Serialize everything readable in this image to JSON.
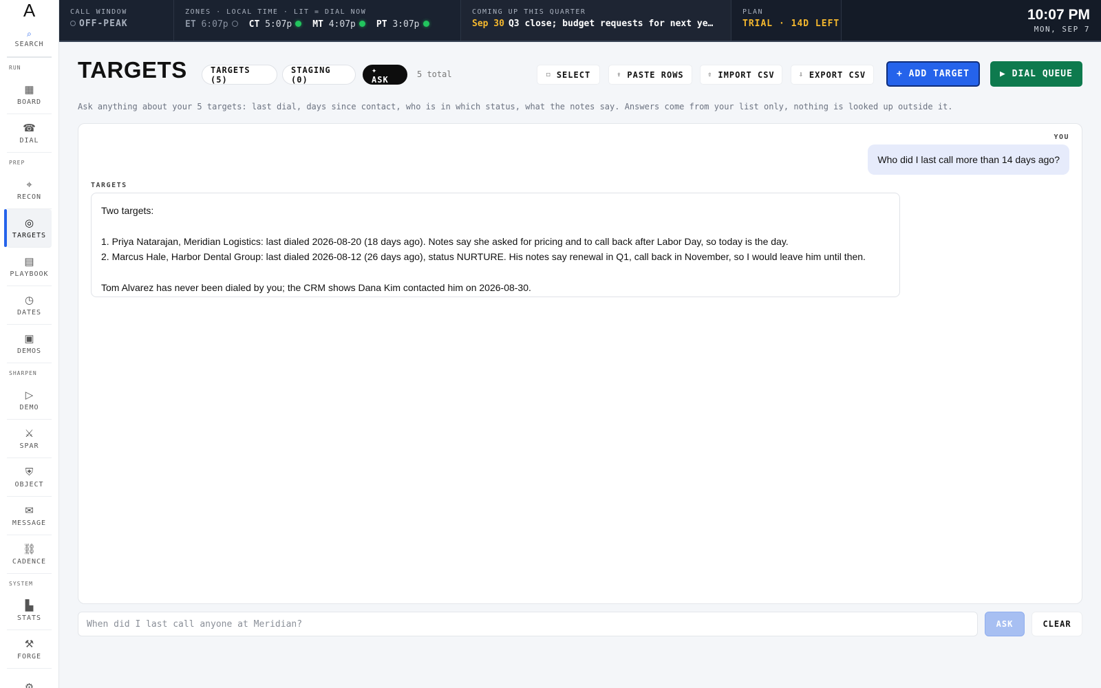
{
  "sidebar": {
    "logo": "A",
    "search": {
      "icon": "search-icon",
      "label": "SEARCH"
    },
    "sections": {
      "run": "RUN",
      "prep": "PREP",
      "sharpen": "SHARPEN",
      "system": "SYSTEM"
    },
    "items": [
      {
        "label": "BOARD",
        "icon": "grid-icon",
        "glyph": "▦"
      },
      {
        "label": "DIAL",
        "icon": "phone-icon",
        "glyph": "☎"
      },
      {
        "label": "RECON",
        "icon": "crosshair-icon",
        "glyph": "⌖"
      },
      {
        "label": "TARGETS",
        "icon": "target-icon",
        "glyph": "◎"
      },
      {
        "label": "PLAYBOOK",
        "icon": "playbook-icon",
        "glyph": "▤"
      },
      {
        "label": "DATES",
        "icon": "clock-icon",
        "glyph": "◷"
      },
      {
        "label": "DEMOS",
        "icon": "screen-icon",
        "glyph": "▣"
      },
      {
        "label": "DEMO",
        "icon": "play-icon",
        "glyph": "▷"
      },
      {
        "label": "SPAR",
        "icon": "swords-icon",
        "glyph": "⚔"
      },
      {
        "label": "OBJECT",
        "icon": "shield-icon",
        "glyph": "⛨"
      },
      {
        "label": "MESSAGE",
        "icon": "envelope-icon",
        "glyph": "✉"
      },
      {
        "label": "CADENCE",
        "icon": "chain-icon",
        "glyph": "⛓"
      },
      {
        "label": "STATS",
        "icon": "bar-chart-icon",
        "glyph": "▙"
      },
      {
        "label": "FORGE",
        "icon": "hammer-icon",
        "glyph": "⚒"
      },
      {
        "label": "SETTINGS",
        "icon": "gear-icon",
        "glyph": "⚙"
      }
    ],
    "active": "TARGETS"
  },
  "topbar": {
    "call_window": {
      "caption": "CALL WINDOW",
      "value": "OFF-PEAK"
    },
    "zones": {
      "caption": "ZONES · LOCAL TIME · LIT = DIAL NOW",
      "items": [
        {
          "code": "ET",
          "time": "6:07p",
          "lit": false
        },
        {
          "code": "CT",
          "time": "5:07p",
          "lit": true
        },
        {
          "code": "MT",
          "time": "4:07p",
          "lit": true
        },
        {
          "code": "PT",
          "time": "3:07p",
          "lit": true
        }
      ]
    },
    "quarter": {
      "caption": "COMING UP THIS QUARTER",
      "date": "Sep 30",
      "text": "Q3 close; budget requests for next ye…"
    },
    "plan": {
      "caption": "PLAN",
      "value": "TRIAL · 14D LEFT"
    },
    "clock": {
      "time": "10:07 PM",
      "date": "MON, SEP 7"
    }
  },
  "main": {
    "title": "TARGETS",
    "tabs": [
      {
        "label": "TARGETS (5)"
      },
      {
        "label": "STAGING (0)"
      },
      {
        "label": "✦ ASK"
      }
    ],
    "total": "5 total",
    "toolbar": {
      "select": {
        "icon": "checkbox-icon",
        "glyph": "☐",
        "label": "SELECT"
      },
      "paste": {
        "icon": "paste-icon",
        "glyph": "⇪",
        "label": "PASTE ROWS"
      },
      "import": {
        "icon": "upload-icon",
        "glyph": "⇧",
        "label": "IMPORT CSV"
      },
      "export": {
        "icon": "download-icon",
        "glyph": "⇩",
        "label": "EXPORT CSV"
      },
      "add": "+ ADD TARGET",
      "dial": "▶ DIAL QUEUE"
    },
    "hint": "Ask anything about your 5 targets: last dial, days since contact, who is in which status, what the notes say. Answers come from your list only, nothing is looked up outside it.",
    "chat": {
      "you_label": "YOU",
      "user_message": "Who did I last call more than 14 days ago?",
      "bot_label": "TARGETS",
      "bot_lines": [
        "Two targets:",
        "",
        "1. Priya Natarajan, Meridian Logistics: last dialed 2026-08-20 (18 days ago). Notes say she asked for pricing and to call back after Labor Day, so today is the day.",
        "2. Marcus Hale, Harbor Dental Group: last dialed 2026-08-12 (26 days ago), status NURTURE. His notes say renewal in Q1, call back in November, so I would leave him until then.",
        "",
        "Tom Alvarez has never been dialed by you; the CRM shows Dana Kim contacted him on 2026-08-30."
      ]
    },
    "ask": {
      "placeholder": "When did I last call anyone at Meridian?",
      "value": "",
      "button": "ASK",
      "clear": "CLEAR"
    }
  },
  "colors": {
    "accent": "#2563eb",
    "success": "#0e7a4e",
    "warning": "#f5b82e",
    "topbar": "#141b27"
  }
}
